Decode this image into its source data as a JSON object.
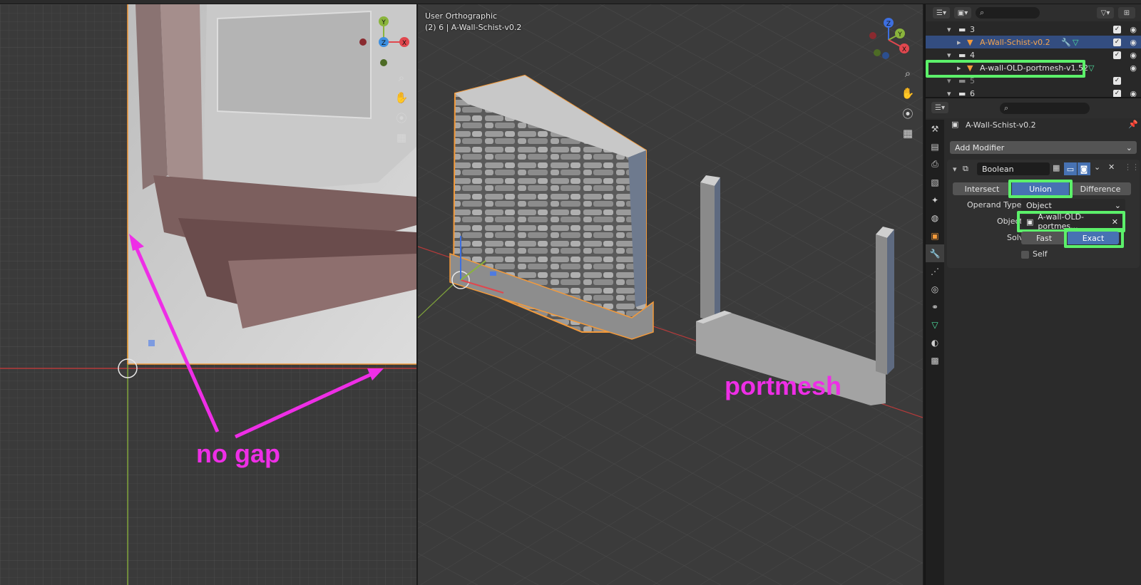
{
  "left_viewport": {
    "gizmo_axes": [
      "Y",
      "Z",
      "X"
    ],
    "nav_icons": [
      "zoom-icon",
      "hand-pan-icon",
      "camera-icon",
      "grid-icon"
    ],
    "annotation": "no gap"
  },
  "main_viewport": {
    "view_name": "User Orthographic",
    "object_info": "(2) 6 | A-Wall-Schist-v0.2",
    "gizmo_axes": [
      "Z",
      "Y",
      "X"
    ],
    "nav_icons": [
      "zoom-icon",
      "hand-pan-icon",
      "camera-icon",
      "grid-icon"
    ],
    "annotation": "portmesh"
  },
  "outliner": {
    "search_placeholder": "",
    "rows": [
      {
        "label": "3",
        "kind": "collection"
      },
      {
        "label": "A-Wall-Schist-v0.2",
        "kind": "mesh",
        "selected": true
      },
      {
        "label": "4",
        "kind": "collection"
      },
      {
        "label": "A-wall-OLD-portmesh-v1.52",
        "kind": "mesh",
        "highlighted": true
      },
      {
        "label": "5",
        "kind": "collection"
      },
      {
        "label": "6",
        "kind": "collection"
      }
    ]
  },
  "properties": {
    "search_placeholder": "",
    "object_name": "A-Wall-Schist-v0.2",
    "add_modifier": "Add Modifier",
    "modifier": {
      "name": "Boolean",
      "operations": [
        "Intersect",
        "Union",
        "Difference"
      ],
      "active_operation": "Union",
      "operand_type_label": "Operand Type",
      "operand_type_value": "Object",
      "object_label": "Object",
      "object_value": "A-wall-OLD-portmes...",
      "solver_label": "Solver",
      "solver_options": [
        "Fast",
        "Exact"
      ],
      "active_solver": "Exact",
      "self_label": "Self"
    }
  },
  "colors": {
    "highlight_green": "#5cf06a",
    "annotation_magenta": "#ee2ee6",
    "selection_orange": "#f39a3b",
    "active_blue": "#4772b3"
  }
}
